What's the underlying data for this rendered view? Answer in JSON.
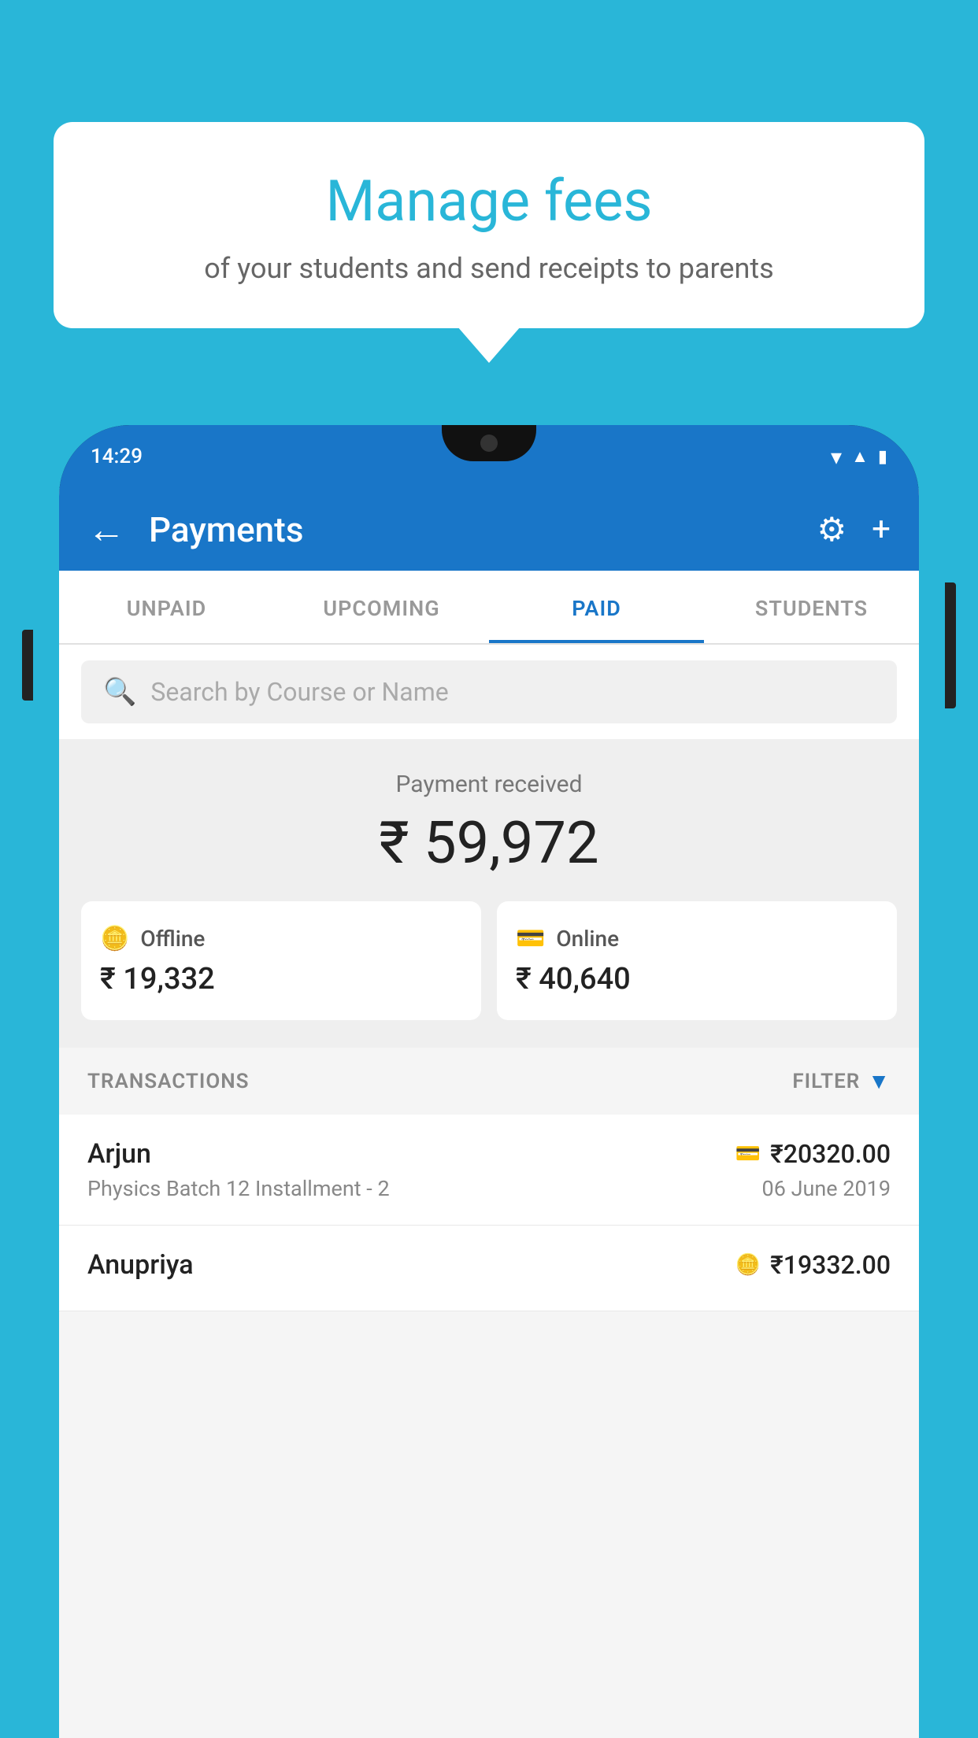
{
  "background_color": "#29b6d8",
  "tooltip": {
    "title": "Manage fees",
    "subtitle": "of your students and send receipts to parents"
  },
  "status_bar": {
    "time": "14:29",
    "icons": [
      "wifi",
      "signal",
      "battery"
    ]
  },
  "header": {
    "back_label": "←",
    "title": "Payments",
    "settings_icon": "⚙",
    "add_icon": "+"
  },
  "tabs": [
    {
      "label": "UNPAID",
      "active": false
    },
    {
      "label": "UPCOMING",
      "active": false
    },
    {
      "label": "PAID",
      "active": true
    },
    {
      "label": "STUDENTS",
      "active": false
    }
  ],
  "search": {
    "placeholder": "Search by Course or Name"
  },
  "payment_summary": {
    "label": "Payment received",
    "total": "₹ 59,972",
    "offline": {
      "type": "Offline",
      "amount": "₹ 19,332"
    },
    "online": {
      "type": "Online",
      "amount": "₹ 40,640"
    }
  },
  "transactions": {
    "header_label": "TRANSACTIONS",
    "filter_label": "FILTER",
    "rows": [
      {
        "name": "Arjun",
        "course": "Physics Batch 12 Installment - 2",
        "amount": "₹20320.00",
        "date": "06 June 2019",
        "payment_type": "online"
      },
      {
        "name": "Anupriya",
        "course": "",
        "amount": "₹19332.00",
        "date": "",
        "payment_type": "offline"
      }
    ]
  }
}
